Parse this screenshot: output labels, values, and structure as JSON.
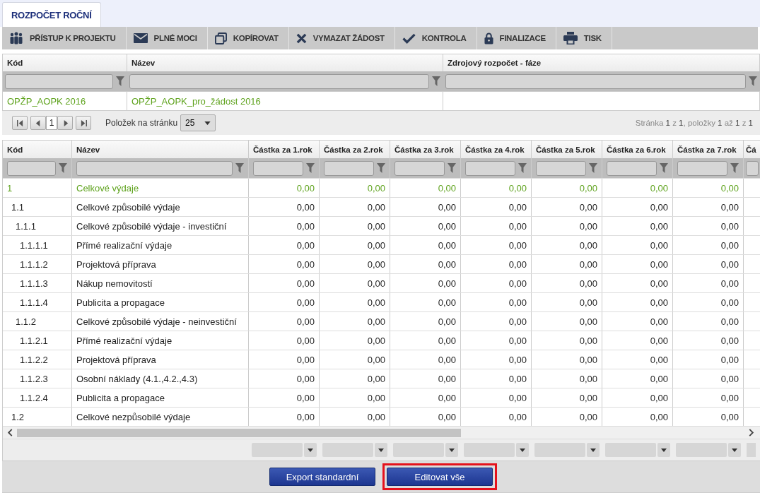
{
  "tab": {
    "label": "ROZPOČET ROČNÍ",
    "selected": true
  },
  "toolbar": [
    {
      "label": "PŘÍSTUP K PROJEKTU"
    },
    {
      "label": "PLNÉ MOCI"
    },
    {
      "label": "KOPÍROVAT"
    },
    {
      "label": "VYMAZAT ŽÁDOST"
    },
    {
      "label": "KONTROLA"
    },
    {
      "label": "FINALIZACE"
    },
    {
      "label": "TISK"
    }
  ],
  "project_table": {
    "columns": [
      "Kód",
      "Název",
      "Zdrojový rozpočet - fáze"
    ],
    "rows": [
      {
        "cells": [
          "OPŽP_AOPK 2016",
          "OPŽP_AOPK_pro_žádost 2016"
        ],
        "selected": true
      }
    ]
  },
  "pager": {
    "page": "1",
    "page_size_label": "Položek na stránku",
    "page_size": "25",
    "status": "Stránka **1** z **1**, položky **1** až **1** z **1**"
  },
  "budget_table": {
    "columns": [
      "Kód",
      "Název",
      "Částka za 1.rok",
      "Částka za 2.rok",
      "Částka za 3.rok",
      "Částka za 4.rok",
      "Částka za 5.rok",
      "Částka za 6.rok",
      "Částka za 7.rok",
      "Čá"
    ],
    "rows": [
      {
        "code": "1",
        "name": "Celkové výdaje",
        "values": [
          "0,00",
          "0,00",
          "0,00",
          "0,00",
          "0,00",
          "0,00",
          "0,00"
        ],
        "selected": true,
        "children": [
          {
            "code": "1.1",
            "name": "Celkové způsobilé výdaje",
            "values": [
              "0,00",
              "0,00",
              "0,00",
              "0,00",
              "0,00",
              "0,00",
              "0,00"
            ],
            "selected": false,
            "children": [
              {
                "code": "1.1.1",
                "name": "Celkové způsobilé výdaje - investiční",
                "values": [
                  "0,00",
                  "0,00",
                  "0,00",
                  "0,00",
                  "0,00",
                  "0,00",
                  "0,00"
                ],
                "selected": false,
                "children": [
                  {
                    "code": "1.1.1.1",
                    "name": "Přímé realizační výdaje",
                    "values": [
                      "0,00",
                      "0,00",
                      "0,00",
                      "0,00",
                      "0,00",
                      "0,00",
                      "0,00"
                    ],
                    "selected": false
                  },
                  {
                    "code": "1.1.1.2",
                    "name": "Projektová příprava",
                    "values": [
                      "0,00",
                      "0,00",
                      "0,00",
                      "0,00",
                      "0,00",
                      "0,00",
                      "0,00"
                    ],
                    "selected": false
                  },
                  {
                    "code": "1.1.1.3",
                    "name": "Nákup nemovitostí",
                    "values": [
                      "0,00",
                      "0,00",
                      "0,00",
                      "0,00",
                      "0,00",
                      "0,00",
                      "0,00"
                    ],
                    "selected": false
                  },
                  {
                    "code": "1.1.1.4",
                    "name": "Publicita a propagace",
                    "values": [
                      "0,00",
                      "0,00",
                      "0,00",
                      "0,00",
                      "0,00",
                      "0,00",
                      "0,00"
                    ],
                    "selected": false
                  }
                ]
              },
              {
                "code": "1.1.2",
                "name": "Celkové způsobilé výdaje - neinvestiční",
                "values": [
                  "0,00",
                  "0,00",
                  "0,00",
                  "0,00",
                  "0,00",
                  "0,00",
                  "0,00"
                ],
                "selected": false,
                "children": [
                  {
                    "code": "1.1.2.1",
                    "name": "Přímé realizační výdaje",
                    "values": [
                      "0,00",
                      "0,00",
                      "0,00",
                      "0,00",
                      "0,00",
                      "0,00",
                      "0,00"
                    ],
                    "selected": false
                  },
                  {
                    "code": "1.1.2.2",
                    "name": "Projektová příprava",
                    "values": [
                      "0,00",
                      "0,00",
                      "0,00",
                      "0,00",
                      "0,00",
                      "0,00",
                      "0,00"
                    ],
                    "selected": false
                  },
                  {
                    "code": "1.1.2.3",
                    "name": "Osobní náklady (4.1.,4.2.,4.3)",
                    "values": [
                      "0,00",
                      "0,00",
                      "0,00",
                      "0,00",
                      "0,00",
                      "0,00",
                      "0,00"
                    ],
                    "selected": false
                  },
                  {
                    "code": "1.1.2.4",
                    "name": "Publicita a propagace",
                    "values": [
                      "0,00",
                      "0,00",
                      "0,00",
                      "0,00",
                      "0,00",
                      "0,00",
                      "0,00"
                    ],
                    "selected": false
                  }
                ]
              }
            ]
          },
          {
            "code": "1.2",
            "name": "Celkové nezpůsobilé výdaje",
            "values": [
              "0,00",
              "0,00",
              "0,00",
              "0,00",
              "0,00",
              "0,00",
              "0,00"
            ],
            "selected": false
          }
        ]
      }
    ]
  },
  "buttons": [
    {
      "label": "Export standardní",
      "highlighted": false
    },
    {
      "label": "Editovat vše",
      "highlighted": true
    }
  ]
}
